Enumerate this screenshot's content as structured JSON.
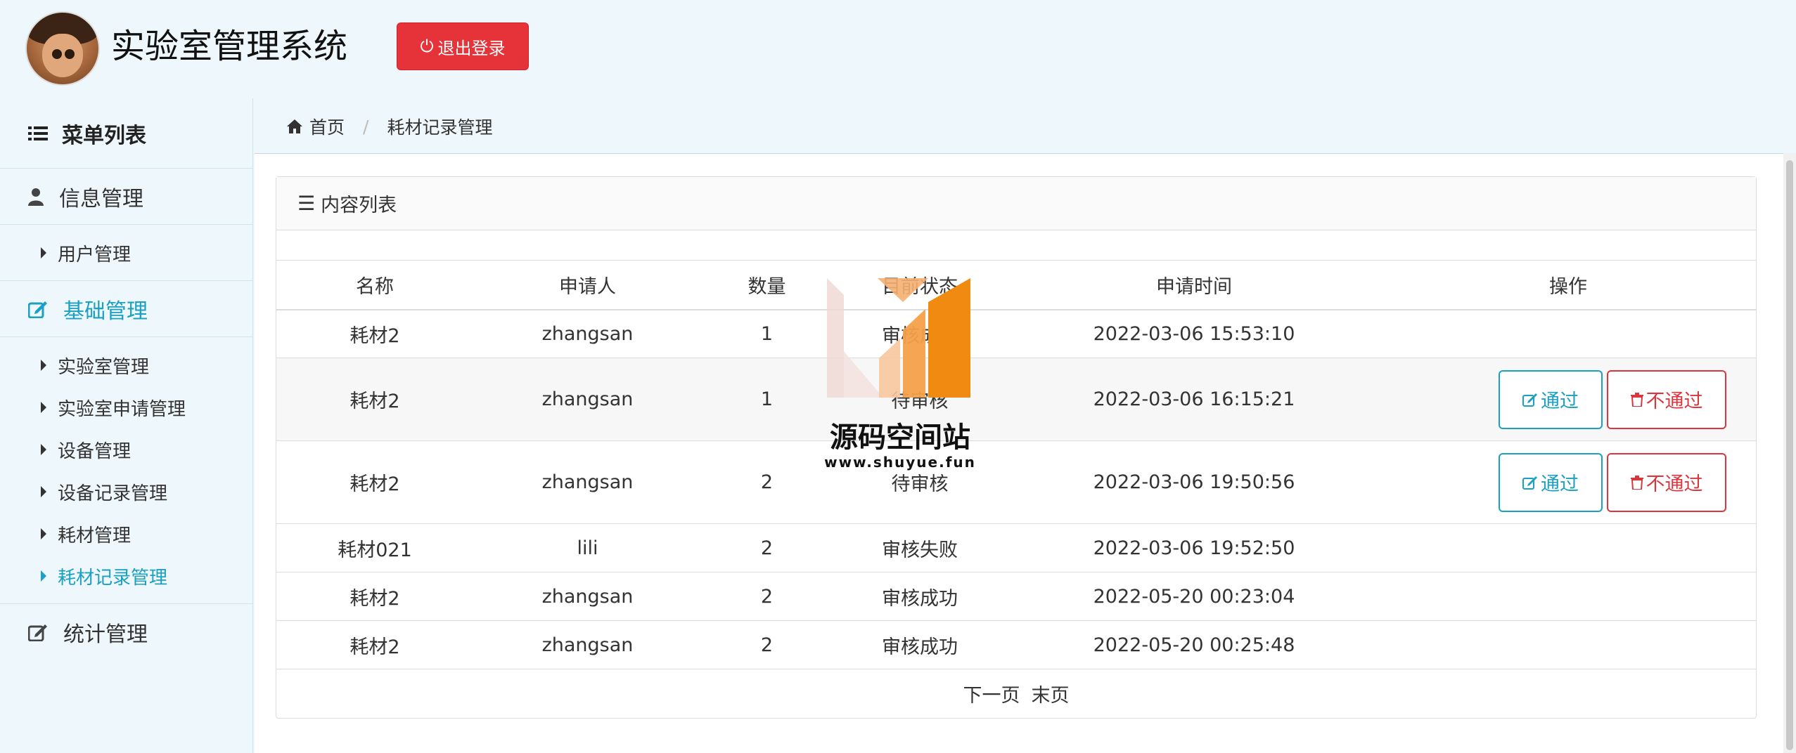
{
  "header": {
    "app_title": "实验室管理系统",
    "logout_label": "退出登录"
  },
  "sidebar": {
    "menu_title": "菜单列表",
    "groups": [
      {
        "label": "信息管理",
        "items": [
          {
            "label": "用户管理"
          }
        ]
      },
      {
        "label": "基础管理",
        "active": true,
        "items": [
          {
            "label": "实验室管理"
          },
          {
            "label": "实验室申请管理"
          },
          {
            "label": "设备管理"
          },
          {
            "label": "设备记录管理"
          },
          {
            "label": "耗材管理"
          },
          {
            "label": "耗材记录管理",
            "active": true
          }
        ]
      },
      {
        "label": "统计管理",
        "items": []
      }
    ]
  },
  "breadcrumb": {
    "home": "首页",
    "current": "耗材记录管理"
  },
  "panel": {
    "title": "内容列表",
    "columns": [
      "名称",
      "申请人",
      "数量",
      "目前状态",
      "申请时间",
      "操作"
    ],
    "rows": [
      {
        "name": "耗材2",
        "applicant": "zhangsan",
        "qty": "1",
        "status": "审核成功",
        "time": "2022-03-06 15:53:10"
      },
      {
        "name": "耗材2",
        "applicant": "zhangsan",
        "qty": "1",
        "status": "待审核",
        "time": "2022-03-06 16:15:21"
      },
      {
        "name": "耗材2",
        "applicant": "zhangsan",
        "qty": "2",
        "status": "待审核",
        "time": "2022-03-06 19:50:56"
      },
      {
        "name": "耗材021",
        "applicant": "lili",
        "qty": "2",
        "status": "审核失败",
        "time": "2022-03-06 19:52:50"
      },
      {
        "name": "耗材2",
        "applicant": "zhangsan",
        "qty": "2",
        "status": "审核成功",
        "time": "2022-05-20 00:23:04"
      },
      {
        "name": "耗材2",
        "applicant": "zhangsan",
        "qty": "2",
        "status": "审核成功",
        "time": "2022-05-20 00:25:48"
      }
    ],
    "actions": {
      "approve": "通过",
      "reject": "不通过"
    },
    "pager": {
      "next": "下一页",
      "last": "末页"
    }
  },
  "watermark": {
    "name": "源码空间站",
    "url": "www.shuyue.fun"
  },
  "colors": {
    "accent": "#1aa0c2",
    "danger": "#e63339",
    "background": "#eef7fb"
  }
}
